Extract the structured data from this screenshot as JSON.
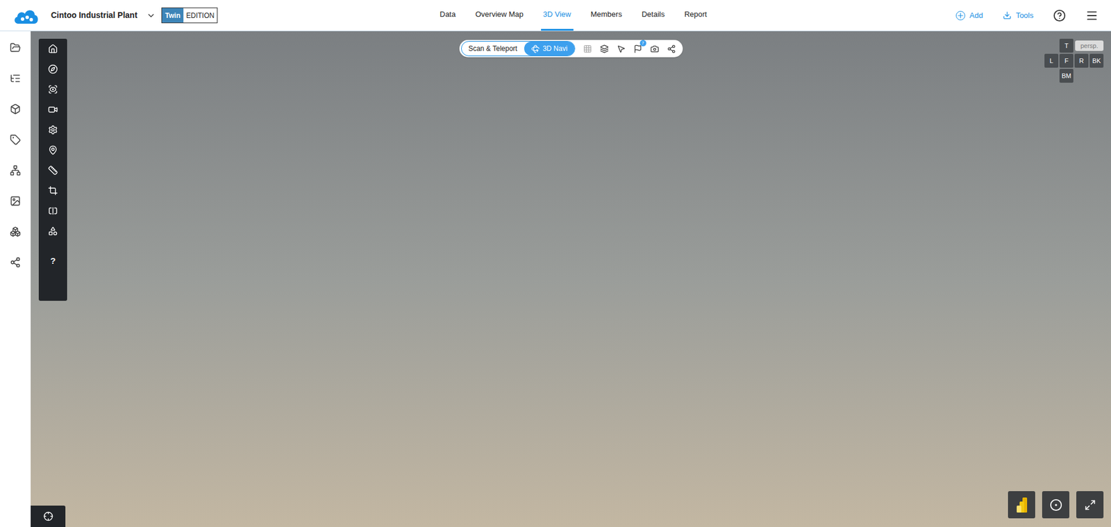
{
  "project": {
    "title": "Cintoo Industrial Plant",
    "edition_label": "Twin",
    "edition_suffix": "EDITION"
  },
  "nav": [
    {
      "label": "Data",
      "selected": false
    },
    {
      "label": "Overview Map",
      "selected": false
    },
    {
      "label": "3D View",
      "selected": true
    },
    {
      "label": "Members",
      "selected": false
    },
    {
      "label": "Details",
      "selected": false
    },
    {
      "label": "Report",
      "selected": false
    }
  ],
  "actions": [
    {
      "label": "Add"
    },
    {
      "label": "Tools"
    }
  ],
  "view_modes": [
    {
      "label": "Scan & Teleport",
      "selected": false
    },
    {
      "label": "3D Navi",
      "selected": true
    }
  ],
  "flag_badge": "7",
  "help_glyph": "?",
  "view_cube": {
    "top": "T",
    "left": "L",
    "front": "F",
    "right": "R",
    "back": "BK",
    "bottom": "BM",
    "projection": "persp."
  }
}
